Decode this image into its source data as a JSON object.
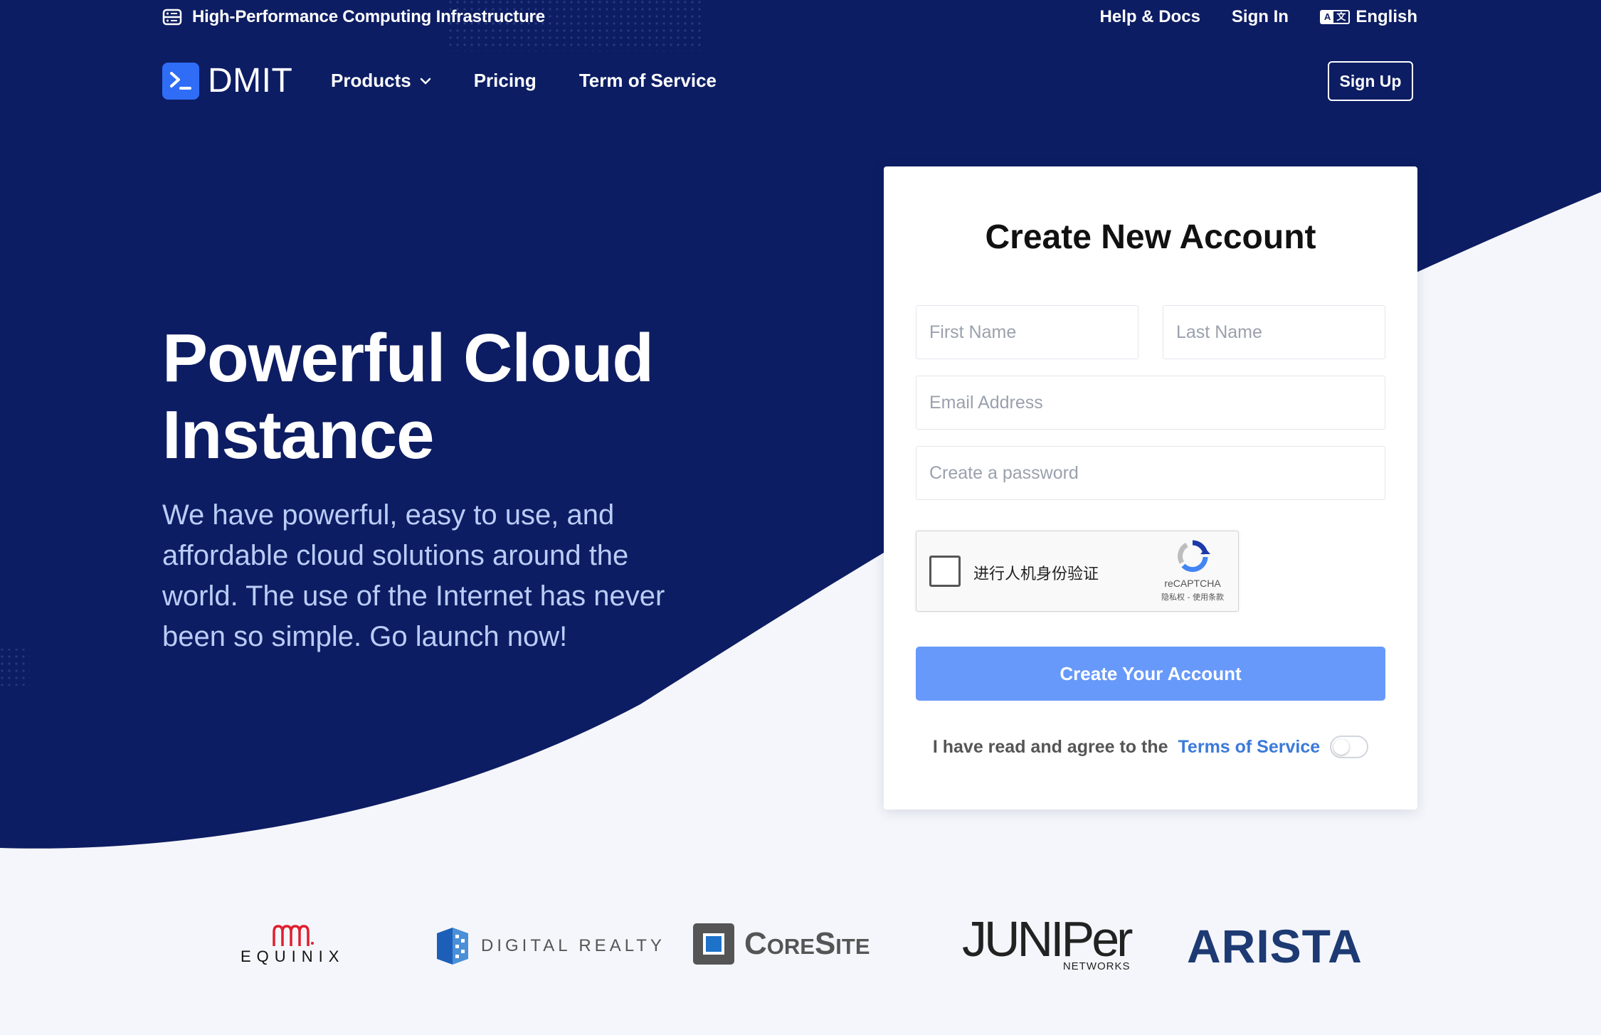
{
  "topbar": {
    "tagline": "High-Performance Computing Infrastructure",
    "help_label": "Help & Docs",
    "signin_label": "Sign In",
    "language_label": "English"
  },
  "nav": {
    "brand_name": "DMIT",
    "products_label": "Products",
    "pricing_label": "Pricing",
    "tos_label": "Term of Service",
    "signup_label": "Sign Up"
  },
  "hero": {
    "title_line1": "Powerful Cloud",
    "title_line2": "Instance",
    "description": "We have powerful, easy to use, and affordable cloud solutions around the world. The use of the Internet has never been so simple. Go launch now!"
  },
  "form": {
    "title": "Create New Account",
    "first_name_placeholder": "First Name",
    "last_name_placeholder": "Last Name",
    "email_placeholder": "Email Address",
    "password_placeholder": "Create a password",
    "captcha_label": "进行人机身份验证",
    "captcha_brand": "reCAPTCHA",
    "captcha_links": "隐私权 - 使用条款",
    "submit_label": "Create Your Account",
    "agree_text": "I have read and agree to the",
    "agree_link": "Terms of Service"
  },
  "partners": {
    "equinix": "EQUINIX",
    "digital_realty": "DIGITAL REALTY",
    "coresite": "CoreSite",
    "juniper": "JUNIPer",
    "juniper_sub": "NETWORKS",
    "arista": "ARISTA"
  },
  "colors": {
    "hero_bg": "#0d1d63",
    "primary": "#2f6df6",
    "button": "#6799fb",
    "link": "#3b7ad9"
  }
}
